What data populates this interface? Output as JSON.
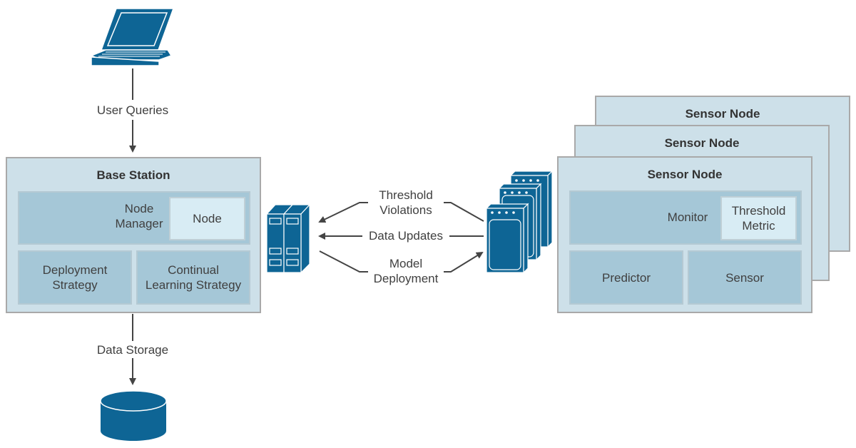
{
  "colors": {
    "icon_blue": "#0e6595",
    "outer_fill": "#cde0e9",
    "mid_fill": "#a5c7d7",
    "light_fill": "#d8ecf4",
    "arrow": "#444444"
  },
  "icons": {
    "client": "laptop-icon",
    "base_station_device": "server-rack-icon",
    "sensor_devices": "sensor-device-stack-icon",
    "storage": "database-icon"
  },
  "edges": {
    "user_queries": "User Queries",
    "data_storage": "Data Storage",
    "threshold_violations": [
      "Threshold",
      "Violations"
    ],
    "data_updates": "Data Updates",
    "model_deployment": [
      "Model",
      "Deployment"
    ]
  },
  "base_station": {
    "title": "Base Station",
    "node_manager": [
      "Node",
      "Manager"
    ],
    "node": "Node",
    "deployment_strategy": [
      "Deployment",
      "Strategy"
    ],
    "continual_learning_strategy": [
      "Continual",
      "Learning Strategy"
    ]
  },
  "sensor_nodes": {
    "back_title": "Sensor Node",
    "middle_title": "Sensor Node",
    "front_title": "Sensor Node",
    "monitor": "Monitor",
    "threshold_metric": [
      "Threshold",
      "Metric"
    ],
    "predictor": "Predictor",
    "sensor": "Sensor"
  }
}
